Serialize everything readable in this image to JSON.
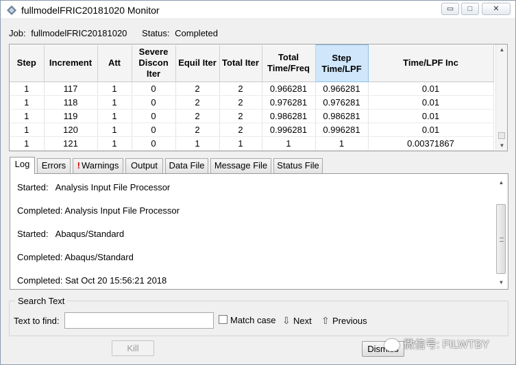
{
  "window": {
    "title": "fullmodelFRIC20181020 Monitor",
    "controls": {
      "minimize": "▭",
      "maximize": "□",
      "close": "✕"
    }
  },
  "job": {
    "job_label": "Job:",
    "job_name": "fullmodelFRIC20181020",
    "status_label": "Status:",
    "status_value": "Completed"
  },
  "table": {
    "headers": [
      "Step",
      "Increment",
      "Att",
      "Severe Discon Iter",
      "Equil Iter",
      "Total Iter",
      "Total Time/Freq",
      "Step Time/LPF",
      "Time/LPF Inc"
    ],
    "rows": [
      [
        "1",
        "117",
        "1",
        "0",
        "2",
        "2",
        "0.966281",
        "0.966281",
        "0.01"
      ],
      [
        "1",
        "118",
        "1",
        "0",
        "2",
        "2",
        "0.976281",
        "0.976281",
        "0.01"
      ],
      [
        "1",
        "119",
        "1",
        "0",
        "2",
        "2",
        "0.986281",
        "0.986281",
        "0.01"
      ],
      [
        "1",
        "120",
        "1",
        "0",
        "2",
        "2",
        "0.996281",
        "0.996281",
        "0.01"
      ],
      [
        "1",
        "121",
        "1",
        "0",
        "1",
        "1",
        "1",
        "1",
        "0.00371867"
      ]
    ]
  },
  "tabs": {
    "items": [
      "Log",
      "Errors",
      "Warnings",
      "Output",
      "Data File",
      "Message File",
      "Status File"
    ],
    "warning_mark": "!",
    "active": "Log"
  },
  "log": {
    "lines": [
      "Started:   Analysis Input File Processor",
      "Completed: Analysis Input File Processor",
      "Started:   Abaqus/Standard",
      "Completed: Abaqus/Standard",
      "Completed: Sat Oct 20 15:56:21 2018"
    ]
  },
  "search": {
    "legend": "Search Text",
    "find_label": "Text to find:",
    "find_value": "",
    "match_case_label": "Match case",
    "next_label": "Next",
    "previous_label": "Previous"
  },
  "buttons": {
    "kill": "Kill",
    "dismiss": "Dismiss"
  },
  "watermark": "微信号: FILWTBY"
}
